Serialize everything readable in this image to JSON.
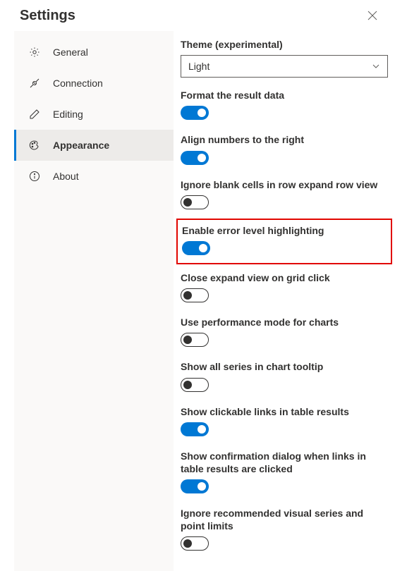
{
  "title": "Settings",
  "sidebar": {
    "items": [
      {
        "label": "General",
        "icon": "settings"
      },
      {
        "label": "Connection",
        "icon": "connection"
      },
      {
        "label": "Editing",
        "icon": "edit"
      },
      {
        "label": "Appearance",
        "icon": "palette",
        "active": true
      },
      {
        "label": "About",
        "icon": "info"
      }
    ]
  },
  "theme": {
    "label": "Theme (experimental)",
    "selected": "Light"
  },
  "settings": [
    {
      "label": "Format the result data",
      "value": true,
      "highlighted": false
    },
    {
      "label": "Align numbers to the right",
      "value": true,
      "highlighted": false
    },
    {
      "label": "Ignore blank cells in row expand row view",
      "value": false,
      "highlighted": false
    },
    {
      "label": "Enable error level highlighting",
      "value": true,
      "highlighted": true
    },
    {
      "label": "Close expand view on grid click",
      "value": false,
      "highlighted": false
    },
    {
      "label": "Use performance mode for charts",
      "value": false,
      "highlighted": false
    },
    {
      "label": "Show all series in chart tooltip",
      "value": false,
      "highlighted": false
    },
    {
      "label": "Show clickable links in table results",
      "value": true,
      "highlighted": false
    },
    {
      "label": "Show confirmation dialog when links in table results are clicked",
      "value": true,
      "highlighted": false
    },
    {
      "label": "Ignore recommended visual series and point limits",
      "value": false,
      "highlighted": false
    }
  ]
}
